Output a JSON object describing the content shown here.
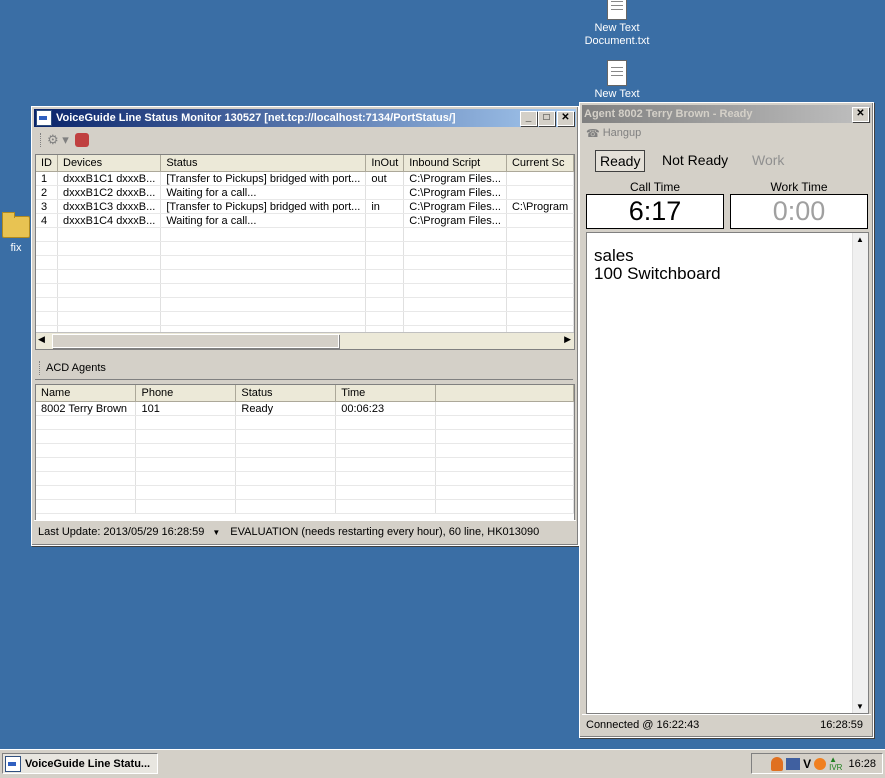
{
  "desktop": {
    "icons": [
      {
        "label_line1": "New Text",
        "label_line2": "Document.txt"
      },
      {
        "label_line1": "New Text",
        "label_line2": ""
      },
      {
        "label_line1": "fix",
        "label_line2": ""
      }
    ]
  },
  "monitor": {
    "title": "VoiceGuide Line Status Monitor 130527 [net.tcp://localhost:7134/PortStatus/]",
    "lines_columns": [
      "ID",
      "Devices",
      "Status",
      "InOut",
      "Inbound Script",
      "Current Sc"
    ],
    "lines_rows": [
      [
        "1",
        "dxxxB1C1 dxxxB...",
        "[Transfer to Pickups] bridged with port...",
        "out",
        "C:\\Program Files...",
        ""
      ],
      [
        "2",
        "dxxxB1C2 dxxxB...",
        "Waiting for a call...",
        "",
        "C:\\Program Files...",
        ""
      ],
      [
        "3",
        "dxxxB1C3 dxxxB...",
        "[Transfer to Pickups] bridged with port...",
        "in",
        "C:\\Program Files...",
        "C:\\Program"
      ],
      [
        "4",
        "dxxxB1C4 dxxxB...",
        "Waiting for a call...",
        "",
        "C:\\Program Files...",
        ""
      ]
    ],
    "acd_label": "ACD Agents",
    "agents_columns": [
      "Name",
      "Phone",
      "Status",
      "Time",
      ""
    ],
    "agents_rows": [
      [
        "8002 Terry Brown",
        "101",
        "Ready",
        "00:06:23",
        ""
      ]
    ],
    "status_last_update": "Last Update: 2013/05/29 16:28:59",
    "status_license": "EVALUATION (needs restarting every hour), 60 line,  HK013090"
  },
  "agent": {
    "title": "Agent 8002 Terry Brown - Ready",
    "hangup_label": "Hangup",
    "ready_label": "Ready",
    "not_ready_label": "Not Ready",
    "work_label": "Work",
    "call_time_label": "Call Time",
    "call_time_value": "6:17",
    "work_time_label": "Work Time",
    "work_time_value": "0:00",
    "info_line1": "sales",
    "info_line2": "100 Switchboard",
    "connected": "Connected @ 16:22:43",
    "clock": "16:28:59"
  },
  "taskbar": {
    "task_label": "VoiceGuide Line Statu...",
    "tray_time": "16:28",
    "tray_ivr": "IVR"
  },
  "colors": {
    "desktop": "#3a6ea5",
    "title_active": "#0a246a",
    "title_inactive": "#808080"
  }
}
